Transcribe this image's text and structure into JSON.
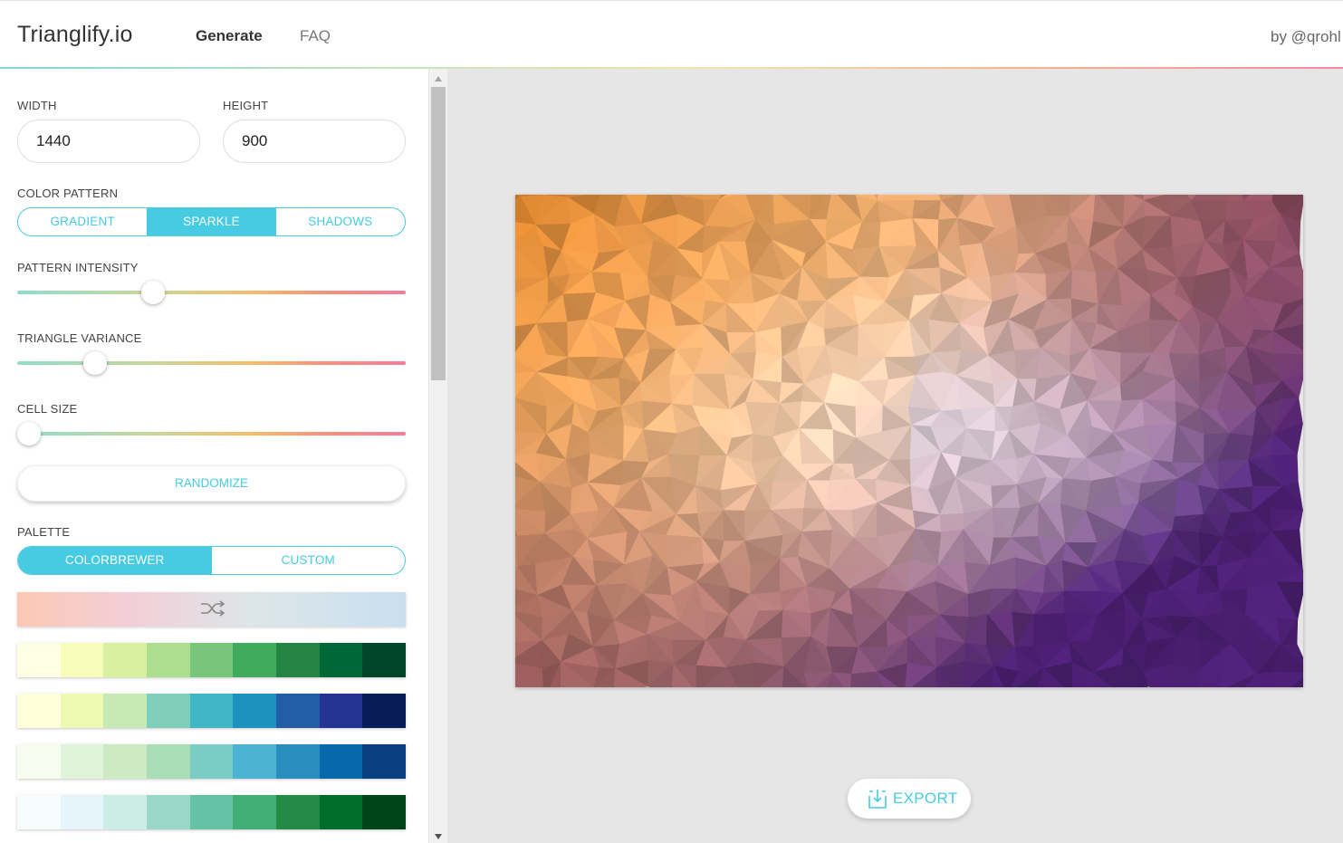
{
  "header": {
    "brand": "Trianglify.io",
    "nav": {
      "generate": "Generate",
      "faq": "FAQ"
    },
    "byline": "by @qrohl"
  },
  "sidebar": {
    "width": {
      "label": "WIDTH",
      "value": "1440"
    },
    "height": {
      "label": "HEIGHT",
      "value": "900"
    },
    "color_pattern": {
      "label": "COLOR PATTERN",
      "options": [
        "GRADIENT",
        "SPARKLE",
        "SHADOWS"
      ],
      "selected": "SPARKLE"
    },
    "pattern_intensity": {
      "label": "PATTERN INTENSITY",
      "value": 0.35
    },
    "triangle_variance": {
      "label": "TRIANGLE VARIANCE",
      "value": 0.2
    },
    "cell_size": {
      "label": "CELL SIZE",
      "value": 0.03
    },
    "randomize_label": "RANDOMIZE",
    "palette": {
      "label": "PALETTE",
      "options": [
        "COLORBREWER",
        "CUSTOM"
      ],
      "selected": "COLORBREWER",
      "shuffle_icon": "shuffle-icon",
      "palettes": [
        [
          "#ffffe5",
          "#f7fcb9",
          "#d9f0a3",
          "#addd8e",
          "#78c679",
          "#41ab5d",
          "#238443",
          "#006837",
          "#004529"
        ],
        [
          "#ffffd9",
          "#edf8b1",
          "#c7e9b4",
          "#7fcdbb",
          "#41b6c4",
          "#1d91c0",
          "#225ea8",
          "#253494",
          "#081d58"
        ],
        [
          "#f7fcf0",
          "#e0f3db",
          "#ccebc5",
          "#a8ddb5",
          "#7bccc4",
          "#4eb3d3",
          "#2b8cbe",
          "#0868ac",
          "#084081"
        ],
        [
          "#f7fcfd",
          "#e5f5f9",
          "#ccece6",
          "#99d8c9",
          "#66c2a4",
          "#41ae76",
          "#238b45",
          "#006d2c",
          "#00441b"
        ]
      ]
    }
  },
  "main": {
    "export_label": "EXPORT",
    "export_icon": "download-icon",
    "preview_colors": {
      "top_left": "#d9822b",
      "center_left": "#f7c28f",
      "center": "#f1ddd4",
      "center_right": "#e4dff0",
      "top_right": "#7e3a52",
      "bottom_left": "#7a3a4a",
      "bottom_right": "#4b1f72"
    }
  }
}
